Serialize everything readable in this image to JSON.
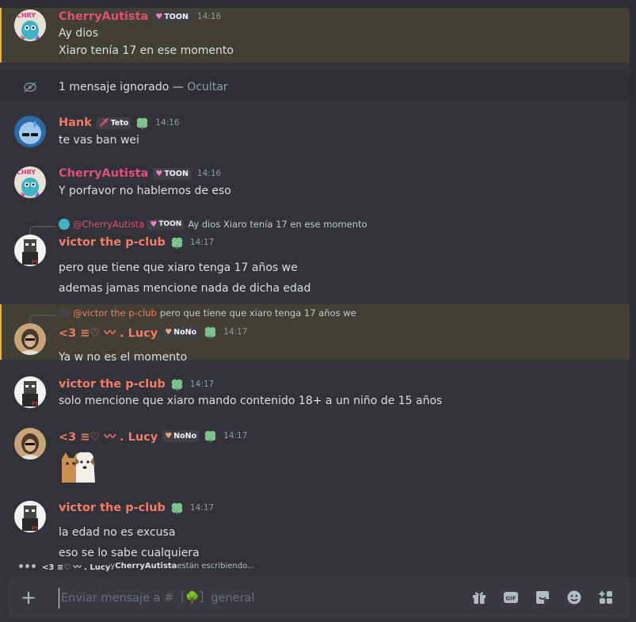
{
  "messages": [
    {
      "author": "CherryAutista",
      "tag": "TOON",
      "time": "14:16",
      "lines": [
        "Ay dios",
        "Xiaro tenía 17 en ese momento"
      ]
    },
    {
      "ignored_text": "1 mensaje ignorado — ",
      "ignored_action": "Ocultar"
    },
    {
      "author": "Hank",
      "tag": "Teto",
      "time": "14:16",
      "lines": [
        "te vas ban wei"
      ]
    },
    {
      "author": "CherryAutista",
      "tag": "TOON",
      "time": "14:16",
      "lines": [
        "Y porfavor no hablemos de eso"
      ]
    },
    {
      "reply_to": "@CherryAutista",
      "reply_tag": "TOON",
      "reply_text": "Ay dios Xiaro tenía 17 en ese momento",
      "author": "victor the p-club",
      "time": "14:17",
      "lines": [
        "pero que tiene que xiaro tenga 17 años we",
        "ademas jamas mencione nada de dicha edad"
      ]
    },
    {
      "reply_to": "@victor the p-club",
      "reply_text": "pero que tiene que xiaro tenga 17 años we",
      "author": "<3 ≡♡ 〰 . Lucy",
      "tag": "NoNo",
      "time": "14:17",
      "lines": [
        "Ya w no es el momento"
      ]
    },
    {
      "author": "victor the p-club",
      "time": "14:17",
      "lines": [
        "solo mencione que xiaro mando contenido 18+ a un niño de 15 años"
      ]
    },
    {
      "author": "<3 ≡♡ 〰 . Lucy",
      "tag": "NoNo",
      "time": "14:17",
      "sticker": "cat-and-dog-sticker"
    },
    {
      "author": "victor the p-club",
      "time": "14:17",
      "lines": [
        "la edad no es excusa",
        "eso se lo sabe cualquiera"
      ]
    }
  ],
  "typing": {
    "user1": "<3 ≡♡ 〰 . Lucy",
    "conj": " y ",
    "user2": "CherryAutista",
    "suffix": " están escribiendo..."
  },
  "composer": {
    "placeholder": "Enviar mensaje a #［🌳］general",
    "icons": [
      "gift-icon",
      "gif-icon",
      "sticker-icon",
      "emoji-icon",
      "apps-icon"
    ]
  },
  "colors": {
    "background": "#313338",
    "highlight": "#423f34",
    "mention_bar": "#f0b232",
    "cherry_name": "#e24f7a",
    "salmon_name": "#f47b67",
    "clover": "#7bc28f"
  }
}
